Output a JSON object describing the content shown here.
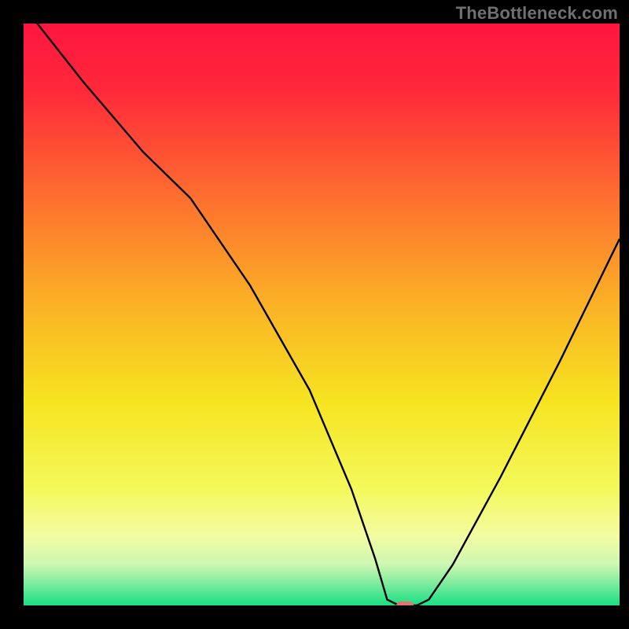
{
  "attribution": "TheBottleneck.com",
  "chart_data": {
    "type": "line",
    "title": "",
    "xlabel": "",
    "ylabel": "",
    "xlim": [
      0,
      100
    ],
    "ylim": [
      0,
      100
    ],
    "x": [
      0,
      10,
      20,
      28,
      38,
      48,
      55,
      59,
      61,
      63,
      64,
      66,
      68,
      72,
      80,
      90,
      100
    ],
    "values": [
      103,
      90,
      78,
      70,
      55,
      37,
      20,
      8,
      1,
      0,
      0,
      0,
      1,
      7,
      22,
      42,
      63
    ],
    "marker": {
      "x": 64,
      "y": 0
    },
    "gradient_stops": [
      {
        "offset": 0.0,
        "color": "#ff153f"
      },
      {
        "offset": 0.12,
        "color": "#ff2a3a"
      },
      {
        "offset": 0.3,
        "color": "#fe6f2f"
      },
      {
        "offset": 0.48,
        "color": "#fbb126"
      },
      {
        "offset": 0.65,
        "color": "#f6e420"
      },
      {
        "offset": 0.8,
        "color": "#f4f95b"
      },
      {
        "offset": 0.88,
        "color": "#f4fca2"
      },
      {
        "offset": 0.93,
        "color": "#ccf7b2"
      },
      {
        "offset": 0.97,
        "color": "#6ae99a"
      },
      {
        "offset": 1.0,
        "color": "#18df84"
      }
    ],
    "line_color": "#000000",
    "marker_color": "#e2766f"
  }
}
